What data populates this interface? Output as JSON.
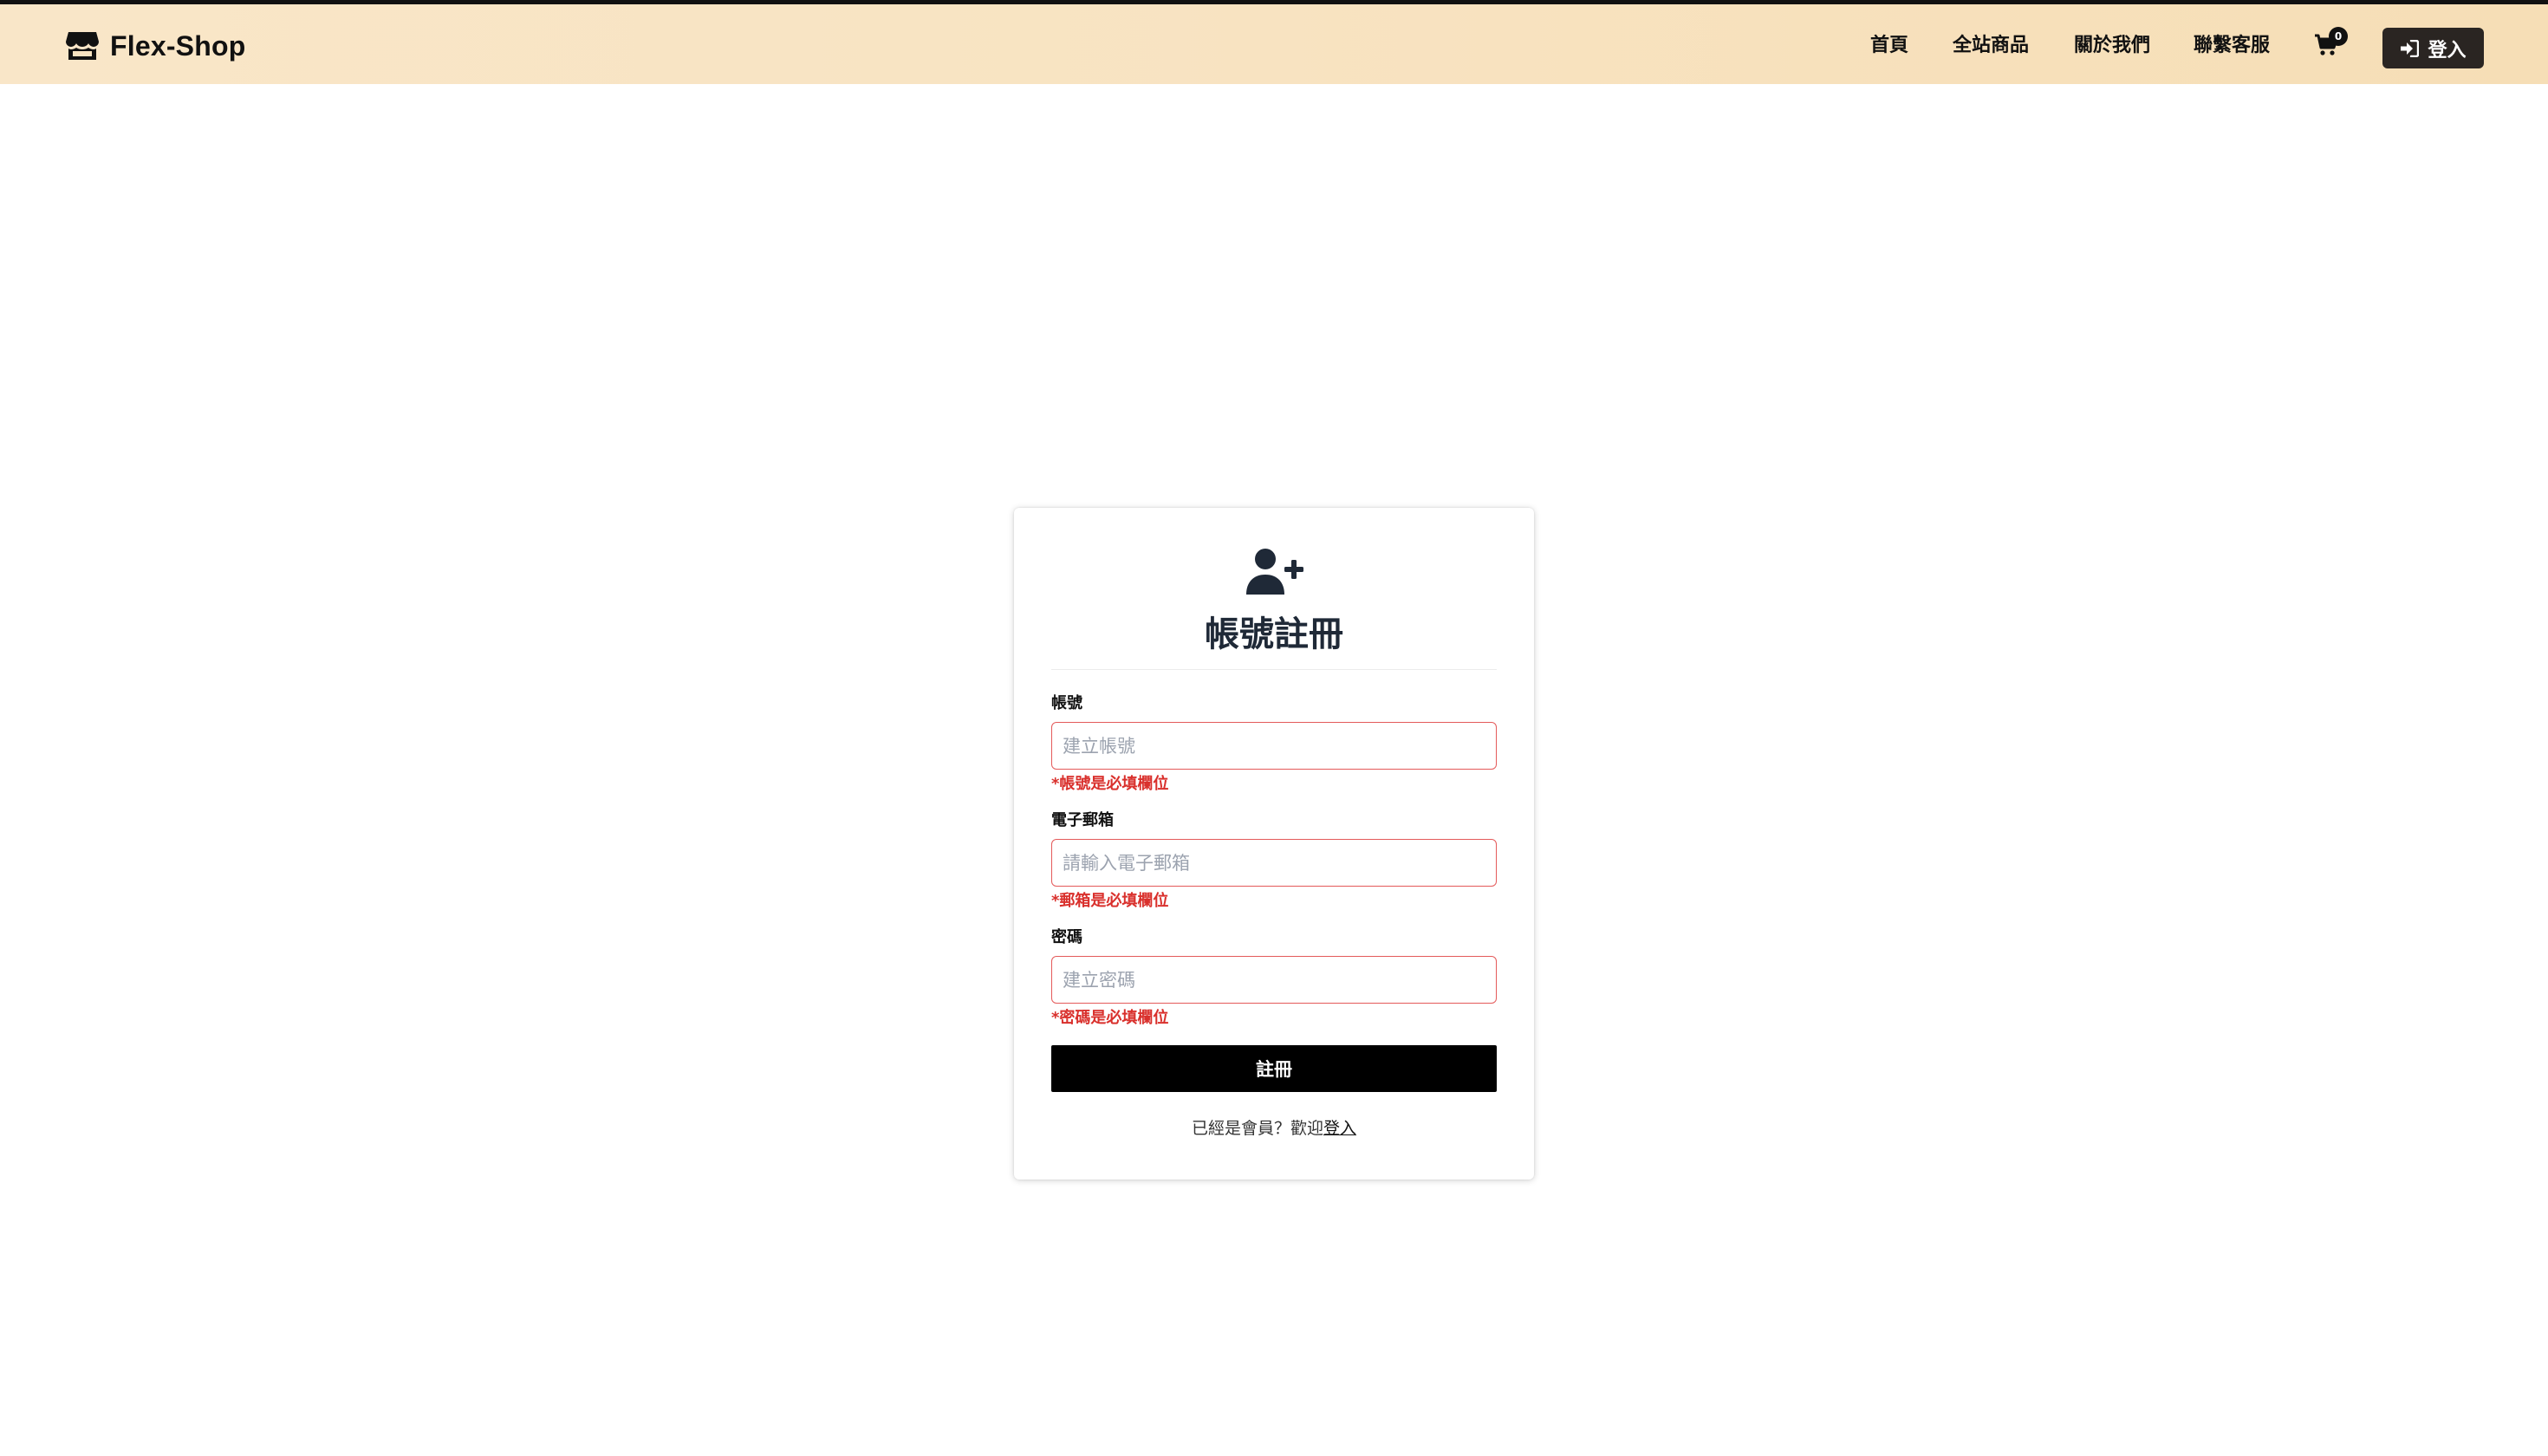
{
  "navbar": {
    "brand": "Flex-Shop",
    "links": {
      "home": "首頁",
      "products": "全站商品",
      "about": "關於我們",
      "contact": "聯繫客服"
    },
    "cart_count": "0",
    "login_label": "登入",
    "colors": {
      "bar_top": "#111111",
      "bg": "#f8e3c1",
      "login_bg": "#2a2522"
    }
  },
  "register": {
    "title": "帳號註冊",
    "account": {
      "label": "帳號",
      "placeholder": "建立帳號",
      "error": "*帳號是必填欄位"
    },
    "email": {
      "label": "電子郵箱",
      "placeholder": "請輸入電子郵箱",
      "error": "*郵箱是必填欄位"
    },
    "password": {
      "label": "密碼",
      "placeholder": "建立密碼",
      "error": "*密碼是必填欄位"
    },
    "submit_label": "註冊",
    "footer_text": "已經是會員？歡迎",
    "footer_link": "登入",
    "colors": {
      "error": "#d9302c",
      "input_border": "#e45a5a",
      "button_bg": "#000000"
    },
    "icon": "user-plus-icon"
  }
}
